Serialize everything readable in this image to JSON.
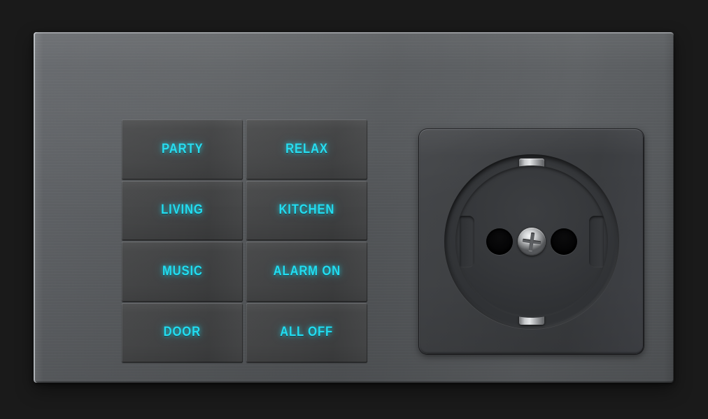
{
  "device": {
    "title": "Smart Switch Panel with Schuko Socket",
    "plate_color": "#5b5e61",
    "button_color": "#434445",
    "label_color": "#22dcf0",
    "background_color": "#1a1a1a"
  },
  "buttons": {
    "columns": [
      {
        "items": [
          {
            "label": "PARTY",
            "name": "button-party"
          },
          {
            "label": "LIVING",
            "name": "button-living"
          },
          {
            "label": "MUSIC",
            "name": "button-music"
          },
          {
            "label": "DOOR",
            "name": "button-door"
          }
        ]
      },
      {
        "items": [
          {
            "label": "RELAX",
            "name": "button-relax"
          },
          {
            "label": "KITCHEN",
            "name": "button-kitchen"
          },
          {
            "label": "ALARM ON",
            "name": "button-alarm-on"
          },
          {
            "label": "ALL OFF",
            "name": "button-all-off"
          }
        ]
      }
    ]
  },
  "socket": {
    "type": "schuko-ce7-3",
    "icons": {
      "usb_a": "usb-a-port-icon",
      "usb_c": "usb-c-port-icon",
      "screw": "phillips-screw-icon",
      "earth_contact": "earth-contact-icon",
      "pin_hole": "pin-hole-icon"
    }
  }
}
